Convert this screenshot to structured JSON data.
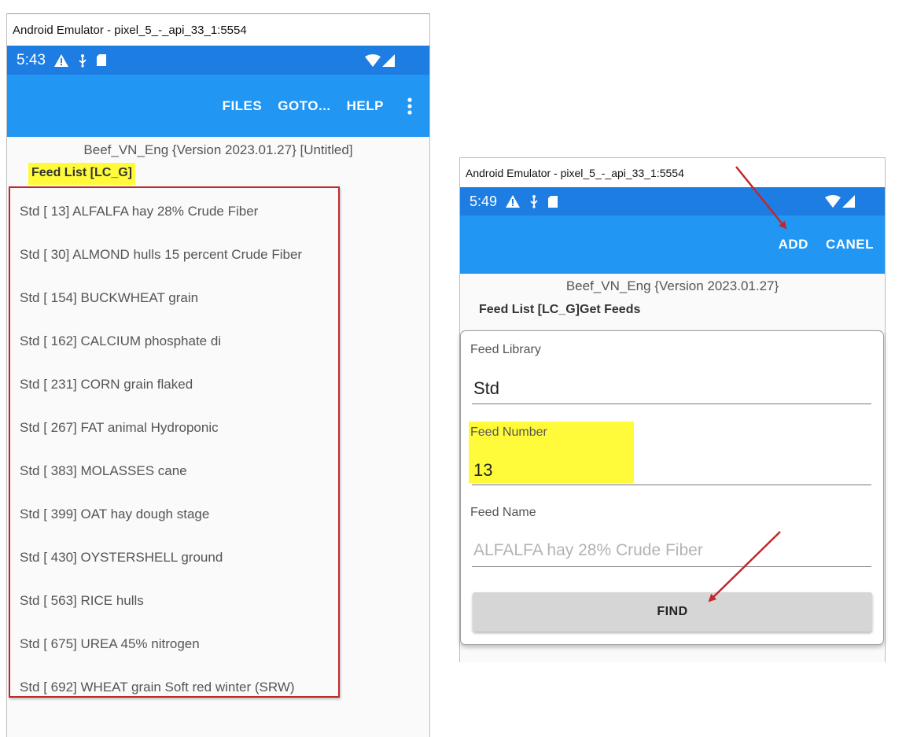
{
  "left_window": {
    "title": "Android Emulator - pixel_5_-_api_33_1:5554",
    "status": {
      "time": "5:43"
    },
    "appbar": {
      "files": "FILES",
      "goto": "GOTO...",
      "help": "HELP"
    },
    "subtitle": "Beef_VN_Eng {Version 2023.01.27}  [Untitled]",
    "list_title": "Feed List [LC_G]",
    "feeds": [
      "Std [  13] ALFALFA hay 28% Crude Fiber",
      "Std [  30] ALMOND hulls 15 percent Crude Fiber",
      "Std [ 154] BUCKWHEAT grain",
      "Std [ 162] CALCIUM phosphate di",
      "Std [ 231] CORN grain flaked",
      "Std [ 267] FAT animal Hydroponic",
      "Std [ 383] MOLASSES cane",
      "Std [ 399] OAT hay dough stage",
      "Std [ 430] OYSTERSHELL ground",
      "Std [ 563] RICE hulls",
      "Std [ 675] UREA 45% nitrogen",
      "Std [ 692] WHEAT grain Soft red winter (SRW)"
    ]
  },
  "right_window": {
    "title": "Android Emulator - pixel_5_-_api_33_1:5554",
    "status": {
      "time": "5:49"
    },
    "appbar": {
      "add": "ADD",
      "cancel": "CANEL"
    },
    "subtitle": "Beef_VN_Eng {Version 2023.01.27}",
    "list_title": "Feed List [LC_G]Get Feeds",
    "form": {
      "library_label": "Feed Library",
      "library_value": "Std",
      "number_label": "Feed Number",
      "number_value": "13",
      "name_label": "Feed Name",
      "name_placeholder": "ALFALFA hay 28% Crude Fiber",
      "find_label": "FIND"
    }
  },
  "colors": {
    "status_bar": "#1e7de3",
    "app_bar": "#2196f3",
    "highlight": "#fffb3a",
    "annotation_red": "#c0282d"
  },
  "icons": [
    "warning-icon",
    "usb-debug-icon",
    "sd-card-icon",
    "wifi-icon",
    "signal-icon",
    "overflow-menu-icon",
    "annotation-arrow"
  ]
}
